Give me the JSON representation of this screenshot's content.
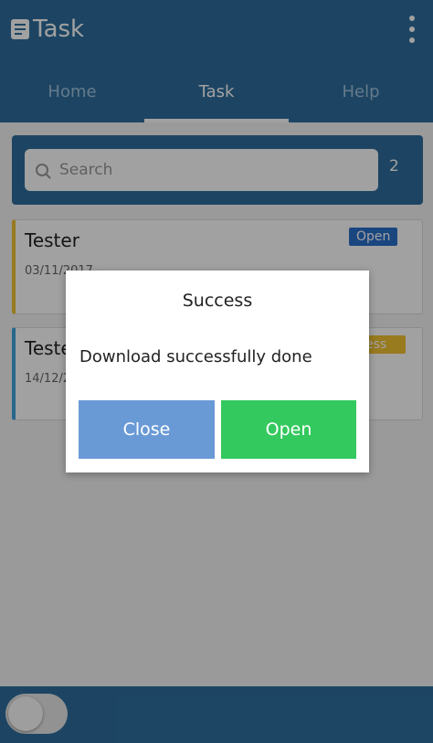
{
  "app_bar": {
    "title": "Task",
    "icon": "document-icon",
    "menu_icon": "overflow-menu-icon",
    "color": "#2e6e9e"
  },
  "tabs": [
    {
      "label": "Home",
      "active": false
    },
    {
      "label": "Task",
      "active": true
    },
    {
      "label": "Help",
      "active": false
    }
  ],
  "search": {
    "placeholder": "Search",
    "value": "",
    "icon": "search-icon",
    "count": "2"
  },
  "tasks": [
    {
      "name": "Tester",
      "date": "03/11/2017 -",
      "status": "Open",
      "status_color": "#2a6fcb",
      "accent": "#f1c232"
    },
    {
      "name": "Tester",
      "date": "14/12/2017 -",
      "status": "Success",
      "status_color": "#f1c232",
      "accent": "#3fa4dc"
    }
  ],
  "bottom_bar": {
    "toggle_on": false
  },
  "dialog": {
    "title": "Success",
    "message": "Download successfully done",
    "close_label": "Close",
    "open_label": "Open",
    "close_color": "#6a9ad6",
    "open_color": "#34c95e"
  }
}
